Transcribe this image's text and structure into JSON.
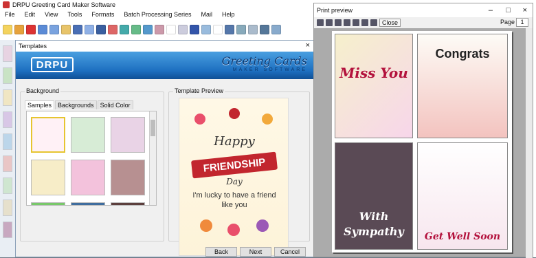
{
  "app": {
    "title": "DRPU Greeting Card Maker Software",
    "menu": [
      "File",
      "Edit",
      "View",
      "Tools",
      "Formats",
      "Batch Processing Series",
      "Mail",
      "Help"
    ]
  },
  "templates_dialog": {
    "title": "Templates",
    "logo_text": "DRPU",
    "brand_title": "Greeting Cards",
    "brand_subtitle": "MAKER SOFTWARE",
    "background_label": "Background",
    "tabs": [
      "Samples",
      "Backgrounds",
      "Solid Color"
    ],
    "active_tab": "Samples",
    "preview_label": "Template Preview",
    "card": {
      "line1": "Happy",
      "ribbon": "FRIENDSHIP",
      "line3": "Day",
      "message": "I'm lucky to have a friend like you"
    },
    "buttons": {
      "back": "Back",
      "next": "Next",
      "cancel": "Cancel"
    }
  },
  "print_preview": {
    "title": "Print preview",
    "close_label": "Close",
    "page_label": "Page",
    "page_value": "1",
    "cards": [
      {
        "text": "Miss You"
      },
      {
        "text": "Congrats"
      },
      {
        "text": "With Sympathy"
      },
      {
        "text": "Get Well Soon"
      }
    ]
  },
  "colors": {
    "banner": "#1d6fc0",
    "ribbon": "#c2262e",
    "miss_you": "#b3123d"
  }
}
